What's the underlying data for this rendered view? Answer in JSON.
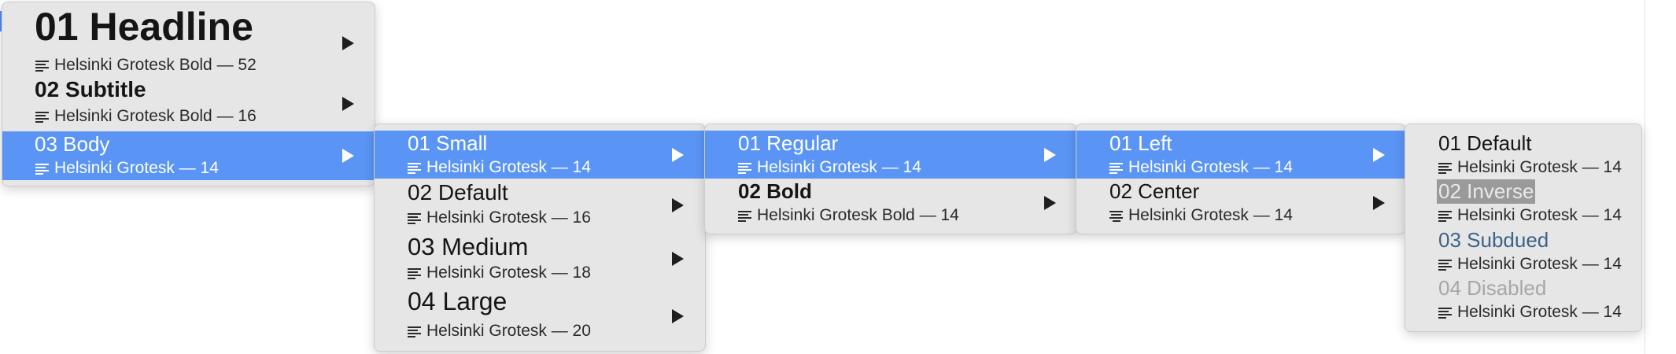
{
  "colors": {
    "highlight": "#5a95f5",
    "menu_bg": "#e6e6e6",
    "subdued": "#3e6388",
    "disabled": "#a7a7a7",
    "inverse_bg": "#9a9a9a"
  },
  "icons": {
    "paragraph": "text-align-icon",
    "submenu": "submenu-arrow-icon"
  },
  "menus": [
    {
      "items": [
        {
          "title": "01 Headline",
          "meta": "Helsinki Grotesk Bold — 52"
        },
        {
          "title": "02 Subtitle",
          "meta": "Helsinki Grotesk Bold — 16"
        },
        {
          "title": "03 Body",
          "meta": "Helsinki Grotesk — 14",
          "selected": true
        }
      ]
    },
    {
      "items": [
        {
          "title": "01 Small",
          "meta": "Helsinki Grotesk — 14",
          "selected": true
        },
        {
          "title": "02 Default",
          "meta": "Helsinki Grotesk — 16"
        },
        {
          "title": "03 Medium",
          "meta": "Helsinki Grotesk — 18"
        },
        {
          "title": "04 Large",
          "meta": "Helsinki Grotesk — 20"
        }
      ]
    },
    {
      "items": [
        {
          "title": "01 Regular",
          "meta": "Helsinki Grotesk — 14",
          "selected": true
        },
        {
          "title": "02 Bold",
          "meta": "Helsinki Grotesk Bold — 14"
        }
      ]
    },
    {
      "items": [
        {
          "title": "01 Left",
          "meta": "Helsinki Grotesk — 14",
          "selected": true,
          "align": "left"
        },
        {
          "title": "02 Center",
          "meta": "Helsinki Grotesk — 14",
          "align": "center"
        }
      ]
    },
    {
      "items": [
        {
          "title": "01 Default",
          "meta": "Helsinki Grotesk — 14"
        },
        {
          "title": "02 Inverse",
          "meta": "Helsinki Grotesk — 14"
        },
        {
          "title": "03 Subdued",
          "meta": "Helsinki Grotesk — 14"
        },
        {
          "title": "04 Disabled",
          "meta": "Helsinki Grotesk — 14",
          "disabled": true
        }
      ]
    }
  ]
}
